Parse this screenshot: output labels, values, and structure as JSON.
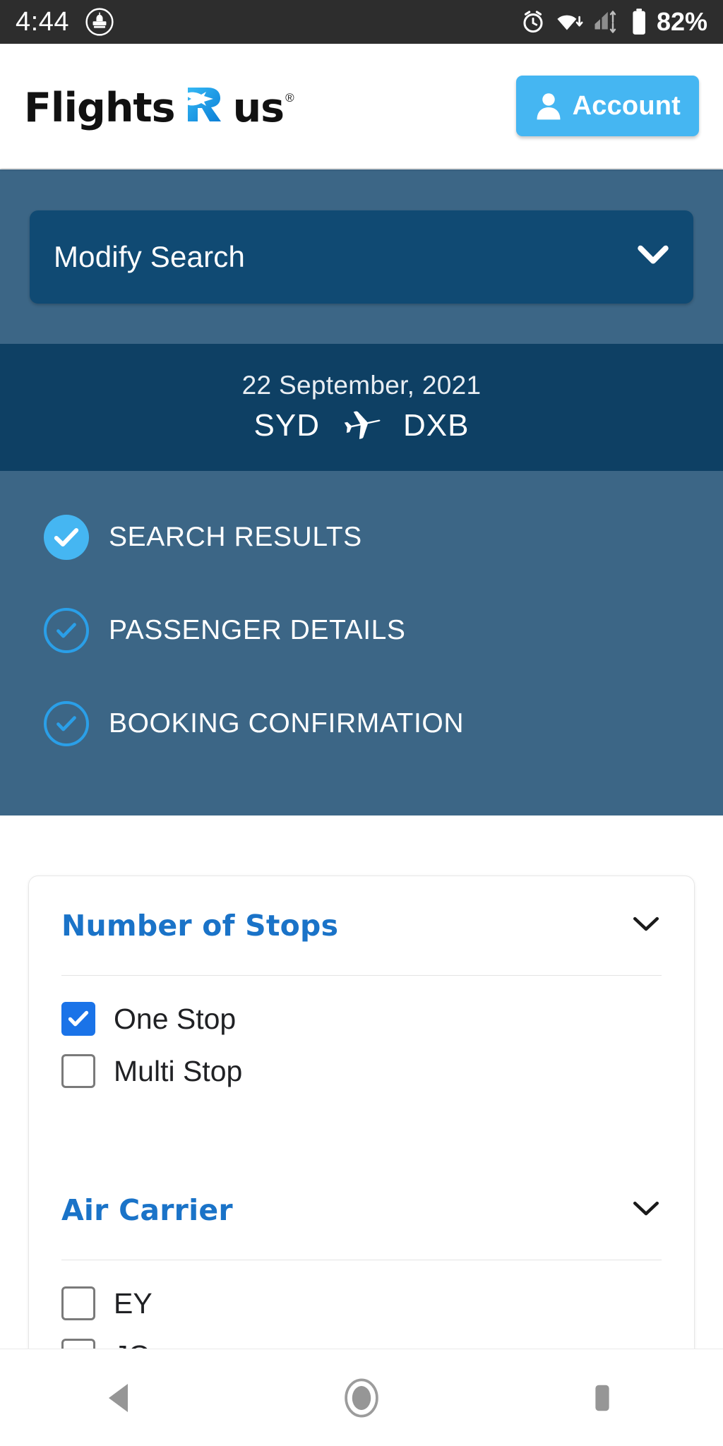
{
  "statusbar": {
    "time": "4:44",
    "battery_text": "82%",
    "icons": [
      "notification-icon",
      "alarm-icon",
      "wifi-icon",
      "cellular-signal-icon",
      "battery-icon"
    ],
    "background": "#2d2d2d"
  },
  "header": {
    "logo": {
      "word1": "Flights",
      "word2": "us",
      "registered": "®",
      "mark": "r-plane-logo"
    },
    "account_button": {
      "label": "Account",
      "color": "#45b6f2"
    }
  },
  "search_panel": {
    "modify_search_label": "Modify Search",
    "modify_search_color": "#104a73",
    "background": "#3c6686"
  },
  "route": {
    "date": "22 September, 2021",
    "origin": "SYD",
    "destination": "DXB",
    "background": "#0e4064"
  },
  "steps": [
    {
      "label": "SEARCH RESULTS",
      "state": "active"
    },
    {
      "label": "PASSENGER DETAILS",
      "state": "inactive"
    },
    {
      "label": "BOOKING CONFIRMATION",
      "state": "inactive"
    }
  ],
  "filters": [
    {
      "title": "Number of Stops",
      "expanded": true,
      "options": [
        {
          "label": "One Stop",
          "checked": true
        },
        {
          "label": "Multi Stop",
          "checked": false
        }
      ]
    },
    {
      "title": "Air Carrier",
      "expanded": true,
      "options": [
        {
          "label": "EY",
          "checked": false
        },
        {
          "label": "JQ",
          "checked": false
        }
      ]
    }
  ],
  "colors": {
    "accent_blue": "#45b6f2",
    "link_blue": "#1a73c8",
    "checkbox_blue": "#1a73e8",
    "panel_blue": "#3c6686",
    "banner_navy": "#0e4064"
  },
  "navbar": {
    "back": "back-triangle",
    "home": "home-circle",
    "recents": "recents-square"
  }
}
